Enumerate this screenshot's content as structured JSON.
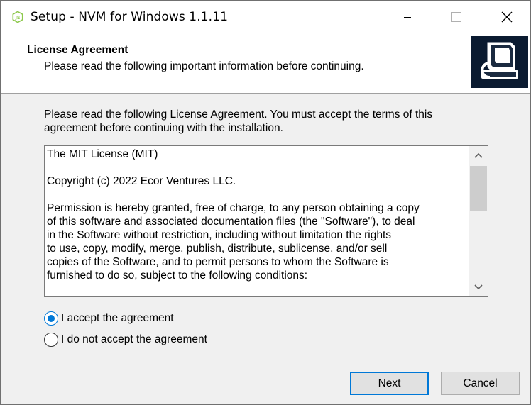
{
  "window": {
    "title": "Setup - NVM for Windows 1.1.11",
    "icon": "nodejs-icon",
    "controls": [
      "minimize-icon",
      "maximize-icon",
      "close-icon"
    ]
  },
  "header": {
    "title": "License Agreement",
    "subtitle": "Please read the following important information before continuing.",
    "image": "setup-wizard-icon"
  },
  "intro": {
    "text": "Please read the following License Agreement. You must accept the terms of this agreement before continuing with the installation."
  },
  "license": {
    "lines": [
      "The MIT License (MIT)",
      "",
      "Copyright (c) 2022 Ecor Ventures LLC.",
      "",
      "Permission is hereby granted, free of charge, to any person obtaining a copy",
      "of this software and associated documentation files (the \"Software\"), to deal",
      "in the Software without restriction, including without limitation the rights",
      "to use, copy, modify, merge, publish, distribute, sublicense, and/or sell",
      "copies of the Software, and to permit persons to whom the Software is",
      "furnished to do so, subject to the following conditions:"
    ]
  },
  "options": {
    "accept_label": "I accept the agreement",
    "decline_label": "I do not accept the agreement",
    "selected": "accept"
  },
  "buttons": {
    "next": "Next",
    "cancel": "Cancel"
  },
  "colors": {
    "accent": "#0078d7",
    "nodejs_green": "#8cc84b",
    "header_image_bg": "#0a1a30"
  }
}
